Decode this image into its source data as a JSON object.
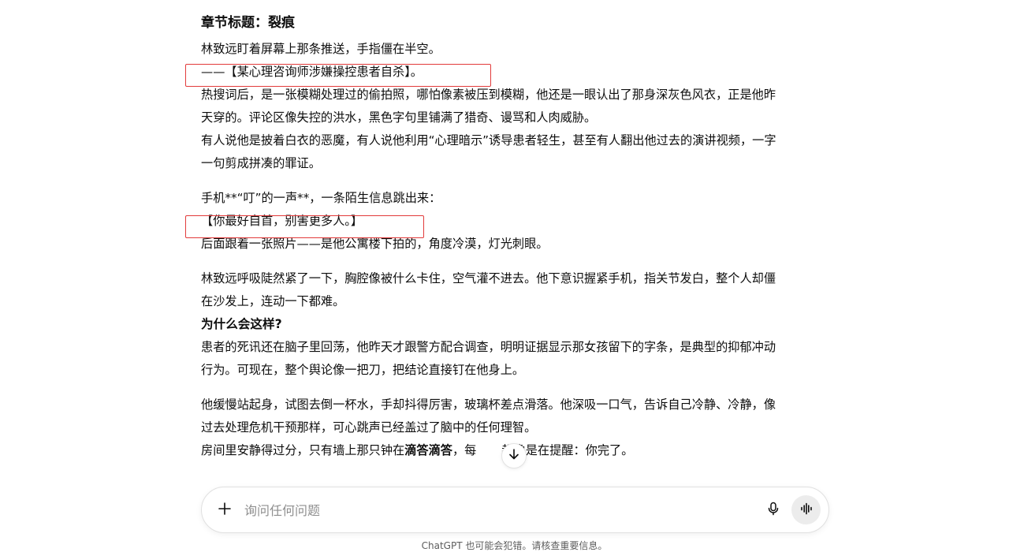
{
  "article": {
    "chapter_title": "章节标题：裂痕",
    "p1": "林致远盯着屏幕上那条推送，手指僵在半空。",
    "p2": "——【某心理咨询师涉嫌操控患者自杀】。",
    "p3a": "热搜词后，是一张模糊处理过的偷拍照，哪怕像素被压到模糊，他还是一眼认出了那身深灰色风衣，正是他昨",
    "p3b": "天穿的。评论区像失控的洪水，黑色字句里铺满了猎奇、谩骂和人肉威胁。",
    "p4a": "有人说他是披着白衣的恶魔，有人说他利用“心理暗示”诱导患者轻生，甚至有人翻出他过去的演讲视频，一字",
    "p4b": "一句剪成拼凑的罪证。",
    "p5": "手机**“叮”的一声**，一条陌生信息跳出来：",
    "p6": "【你最好自首，别害更多人。】",
    "p7": "后面跟着一张照片——是他公寓楼下拍的，角度冷漠，灯光刺眼。",
    "p8a": "林致远呼吸陡然紧了一下，胸腔像被什么卡住，空气灌不进去。他下意识握紧手机，指关节发白，整个人却僵",
    "p8b": "在沙发上，连动一下都难。",
    "p9": "为什么会这样?",
    "p10a": "患者的死讯还在脑子里回荡，他昨天才跟警方配合调查，明明证据显示那女孩留下的字条，是典型的抑郁冲动",
    "p10b": "行为。可现在，整个舆论像一把刀，把结论直接钉在他身上。",
    "p11a": "他缓慢站起身，试图去倒一杯水，手却抖得厉害，玻璃杯差点滑落。他深吸一口气，告诉自己冷静、冷静，像",
    "p11b": "过去处理危机干预那样，可心跳声已经盖过了脑中的任何理智。",
    "p12_pre": "房间里安静得过分，只有墙上那只钟在",
    "p12_bold": "滴答滴答",
    "p12_mid": "，每",
    "p12_post": "都像是在提醒：你完了。"
  },
  "composer": {
    "placeholder": "询问任何问题",
    "value": ""
  },
  "disclaimer": "ChatGPT 也可能会犯错。请核查重要信息。",
  "icons": {
    "scroll": "arrow-down-icon",
    "add": "plus-icon",
    "mic": "microphone-icon",
    "voice": "voice-mode-icon"
  },
  "colors": {
    "highlight_border": "#e23b3b",
    "text": "#0d0d0d",
    "placeholder": "#8f8f8f",
    "voice_button_bg": "#ececec"
  }
}
